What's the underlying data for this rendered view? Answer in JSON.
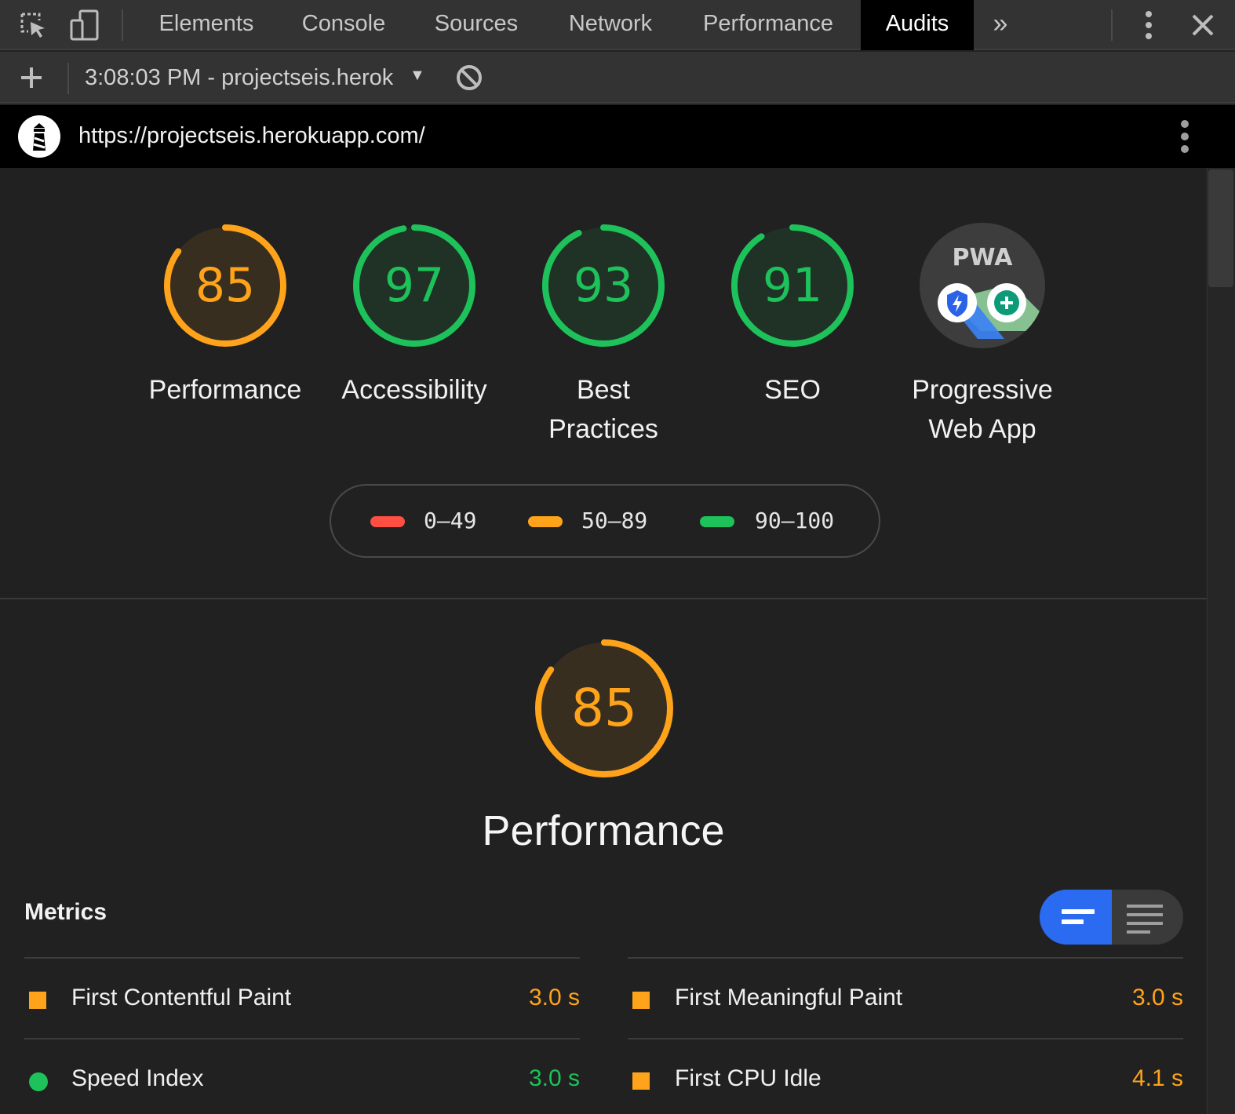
{
  "devtools": {
    "tabs": [
      "Elements",
      "Console",
      "Sources",
      "Network",
      "Performance",
      "Audits"
    ],
    "active_tab": "Audits",
    "more_tabs_glyph": "»"
  },
  "toolbar": {
    "report_label": "3:08:03 PM - projectseis.herok",
    "dropdown_glyph": "▼"
  },
  "report": {
    "url": "https://projectseis.herokuapp.com/"
  },
  "gauges": [
    {
      "label": "Performance",
      "score": 85,
      "fraction": 0.85,
      "color": "#ffa31a"
    },
    {
      "label": "Accessibility",
      "score": 97,
      "fraction": 0.97,
      "color": "#1ec25a"
    },
    {
      "label_line1": "Best",
      "label_line2": "Practices",
      "score": 93,
      "fraction": 0.93,
      "color": "#1ec25a"
    },
    {
      "label": "SEO",
      "score": 91,
      "fraction": 0.91,
      "color": "#1ec25a"
    }
  ],
  "pwa": {
    "badge_text": "PWA",
    "label_line1": "Progressive",
    "label_line2": "Web App"
  },
  "legend": [
    {
      "range": "0–49",
      "color": "#ff4e42"
    },
    {
      "range": "50–89",
      "color": "#ffa31a"
    },
    {
      "range": "90–100",
      "color": "#1ec25a"
    }
  ],
  "category": {
    "title": "Performance",
    "score": 85,
    "fraction": 0.85,
    "color": "#ffa31a"
  },
  "metrics": {
    "title": "Metrics",
    "items": [
      {
        "name": "First Contentful Paint",
        "value": "3.0 s",
        "status": "average",
        "color": "#ffa31a"
      },
      {
        "name": "First Meaningful Paint",
        "value": "3.0 s",
        "status": "average",
        "color": "#ffa31a"
      },
      {
        "name": "Speed Index",
        "value": "3.0 s",
        "status": "pass",
        "color": "#1ec25a"
      },
      {
        "name": "First CPU Idle",
        "value": "4.1 s",
        "status": "average",
        "color": "#ffa31a"
      }
    ]
  }
}
